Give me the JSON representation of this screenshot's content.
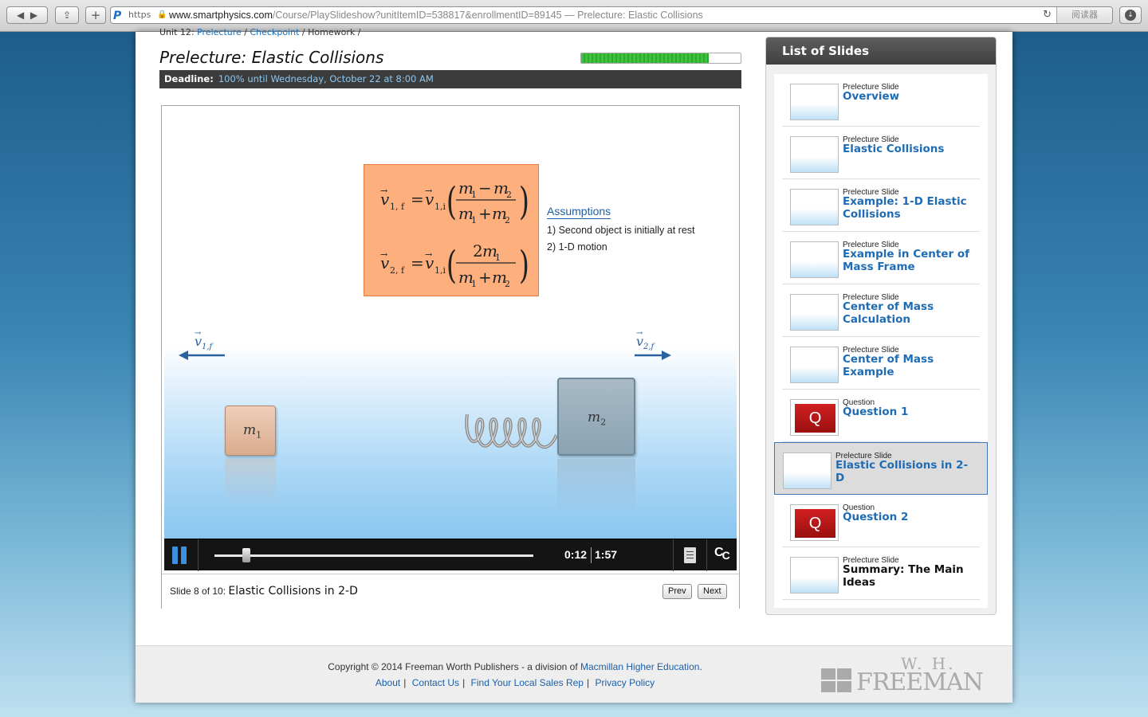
{
  "browser": {
    "logo": "P",
    "https_label": "https",
    "url_host": "www.smartphysics.com",
    "url_path": "/Course/PlaySlideshow?unitItemID=538817&enrollmentID=89145",
    "page_title": "— Prelecture: Elastic Collisions",
    "reader_label": "阅读器"
  },
  "breadcrumb": {
    "unit": "Unit 12:",
    "prelecture": "Prelecture",
    "checkpoint": "Checkpoint",
    "homework": "Homework"
  },
  "header": {
    "title": "Prelecture: Elastic Collisions",
    "progress_fraction": 0.8,
    "deadline_label": "Deadline:",
    "deadline_value": "100% until Wednesday, October 22 at 8:00 AM"
  },
  "slide": {
    "formula_lines": [
      "v⃗1,f = v⃗1,i (m1 − m2) / (m1 + m2)",
      "v⃗2,f = v⃗1,i (2m1) / (m1 + m2)"
    ],
    "assumptions_title": "Assumptions",
    "assumptions": [
      "1) Second object is initially at rest",
      "2) 1-D motion"
    ],
    "velocity_left": "v⃗1,f",
    "velocity_right": "v⃗2,f",
    "mass1_label": "m",
    "mass1_sub": "1",
    "mass2_label": "m",
    "mass2_sub": "2"
  },
  "player": {
    "current_time": "0:12",
    "total_time": "1:57",
    "progress_fraction": 0.1,
    "cc_label": "C",
    "cc_sub": "C"
  },
  "slidebar": {
    "slide_prefix": "Slide 8 of 10:",
    "slide_name": "Elastic Collisions in 2-D",
    "prev_label": "Prev",
    "next_label": "Next"
  },
  "slide_list": {
    "heading": "List of Slides",
    "items": [
      {
        "type": "Prelecture Slide",
        "name": "Overview",
        "question": false,
        "dark": false
      },
      {
        "type": "Prelecture Slide",
        "name": "Elastic Collisions",
        "question": false,
        "dark": false
      },
      {
        "type": "Prelecture Slide",
        "name": "Example: 1-D Elastic Collisions",
        "question": false,
        "dark": false
      },
      {
        "type": "Prelecture Slide",
        "name": "Example in Center of Mass Frame",
        "question": false,
        "dark": false
      },
      {
        "type": "Prelecture Slide",
        "name": "Center of Mass Calculation",
        "question": false,
        "dark": false
      },
      {
        "type": "Prelecture Slide",
        "name": "Center of Mass Example",
        "question": false,
        "dark": false
      },
      {
        "type": "Question",
        "name": "Question 1",
        "question": true,
        "dark": false
      },
      {
        "type": "Prelecture Slide",
        "name": "Elastic Collisions in 2-D",
        "question": false,
        "dark": false,
        "active": true
      },
      {
        "type": "Question",
        "name": "Question 2",
        "question": true,
        "dark": false
      },
      {
        "type": "Prelecture Slide",
        "name": "Summary: The Main Ideas",
        "question": false,
        "dark": true
      }
    ],
    "question_glyph": "Q"
  },
  "footer": {
    "copyright_prefix": "Copyright © 2014 Freeman Worth Publishers - a division of",
    "copyright_link": "Macmillan Higher Education",
    "copyright_suffix": ".",
    "links": [
      "About",
      "Contact Us",
      "Find Your Local Sales Rep",
      "Privacy Policy"
    ],
    "brand_top": "W. H.",
    "brand_bottom": "FREEMAN"
  },
  "colors": {
    "link_blue": "#1e6cb5",
    "progress_green": "#3fc03f",
    "formula_orange": "#fdb07e",
    "play_blue": "#3d8fe0"
  }
}
